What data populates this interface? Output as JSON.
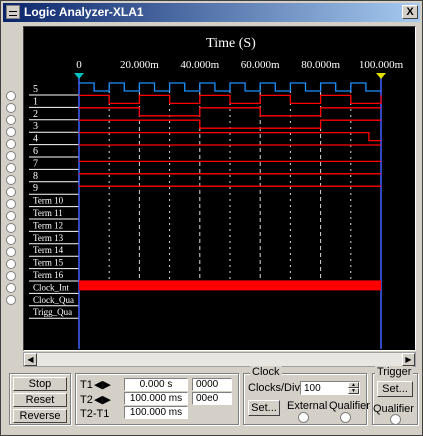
{
  "window": {
    "title": "Logic Analyzer-XLA1",
    "close": "X"
  },
  "display": {
    "time_title": "Time (S)",
    "time_ticks": [
      "0",
      "20.000m",
      "40.000m",
      "60.000m",
      "80.000m",
      "100.000m"
    ],
    "channel_labels": [
      "5",
      "1",
      "2",
      "3",
      "4",
      "6",
      "7",
      "8",
      "9",
      "Term 10",
      "Term 11",
      "Term 12",
      "Term 13",
      "Term 14",
      "Term 15",
      "Term 16",
      "Clock_Int",
      "Clock_Qua",
      "Trigg_Qua"
    ],
    "colors": {
      "background": "#000000",
      "trace": "#ff0000",
      "clock_trace": "#1e90ff",
      "grid": "#ffffff",
      "cursor": "#4060ff",
      "t1_marker": "#00c0c0",
      "t2_marker": "#e0e000"
    }
  },
  "controls": {
    "stop": "Stop",
    "reset": "Reset",
    "reverse": "Reverse",
    "t1_label": "T1",
    "t2_label": "T2",
    "t2t1_label": "T2-T1",
    "t1_value": "0.000 s",
    "t2_value": "100.000 ms",
    "t2t1_value": "100.000 ms",
    "t1_hex": "0000",
    "t2_hex": "00e0",
    "arrow_icon": "◀▶"
  },
  "clock": {
    "legend": "Clock",
    "clocks_div_label": "Clocks/Div",
    "clocks_div_value": "100",
    "set_label": "Set...",
    "external_label": "External",
    "qualifier_label": "Qualifier"
  },
  "trigger": {
    "legend": "Trigger",
    "set_label": "Set...",
    "qualifier_label": "Qualifier"
  }
}
